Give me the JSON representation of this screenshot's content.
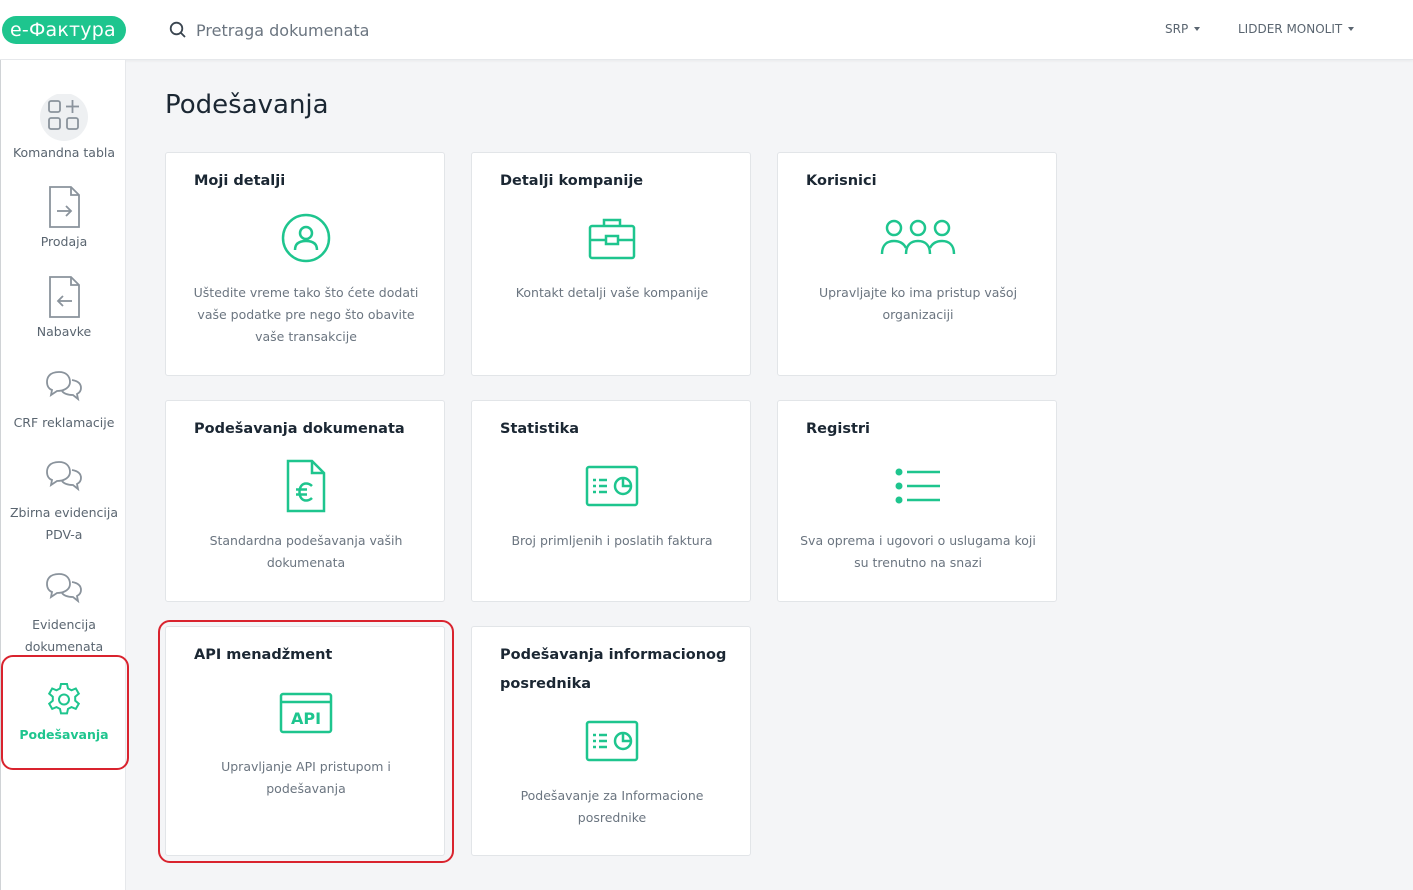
{
  "header": {
    "logo": "e-Фактура",
    "search_placeholder": "Pretraga dokumenata",
    "language": "SRP",
    "company": "LIDDER MONOLIT"
  },
  "sidebar": {
    "items": [
      {
        "label": "Komandna tabla",
        "icon": "dashboard-icon"
      },
      {
        "label": "Prodaja",
        "icon": "document-arrow-right-icon"
      },
      {
        "label": "Nabavke",
        "icon": "document-arrow-left-icon"
      },
      {
        "label": "CRF reklamacije",
        "icon": "chat-bubbles-icon"
      },
      {
        "label": "Zbirna evidencija PDV-a",
        "icon": "chat-bubbles-icon"
      },
      {
        "label": "Evidencija dokumenata",
        "icon": "chat-bubbles-icon"
      },
      {
        "label": "Podešavanja",
        "icon": "gear-icon",
        "active": true
      }
    ]
  },
  "main": {
    "title": "Podešavanja",
    "cards": [
      {
        "title": "Moji detalji",
        "desc": "Uštedite vreme tako što ćete dodati vaše podatke pre nego što obavite vaše transakcije",
        "icon": "user-circle-icon"
      },
      {
        "title": "Detalji kompanije",
        "desc": "Kontakt detalji vaše kompanije",
        "icon": "briefcase-icon"
      },
      {
        "title": "Korisnici",
        "desc": "Upravljajte ko ima pristup vašoj organizaciji",
        "icon": "users-group-icon"
      },
      {
        "title": "Podešavanja dokumenata",
        "desc": "Standardna podešavanja vaših dokumenata",
        "icon": "euro-document-icon"
      },
      {
        "title": "Statistika",
        "desc": "Broj primljenih i poslatih faktura",
        "icon": "statistics-chart-icon"
      },
      {
        "title": "Registri",
        "desc": "Sva oprema i ugovori o uslugama koji su trenutno na snazi",
        "icon": "list-icon"
      },
      {
        "title": "API menadžment",
        "desc": "Upravljanje API pristupom i podešavanja",
        "icon": "api-icon",
        "icon_text": "API"
      },
      {
        "title": "Podešavanja informacionog posrednika",
        "desc": "Podešavanje za Informacione posrednike",
        "icon": "statistics-chart-icon"
      }
    ]
  },
  "colors": {
    "accent": "#1ec58e",
    "highlight": "#d9232e",
    "icon_gray": "#8a939c"
  }
}
